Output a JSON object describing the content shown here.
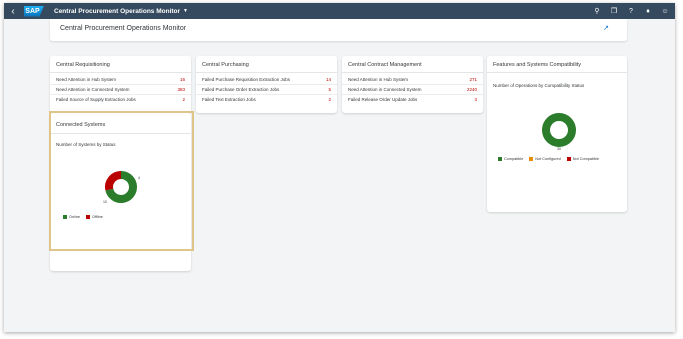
{
  "shell": {
    "title": "Central Procurement Operations Monitor",
    "icons": [
      "back-icon",
      "search-icon",
      "copy-icon",
      "help-icon",
      "bell-icon",
      "user-icon"
    ]
  },
  "page": {
    "title": "Central Procurement Operations Monitor"
  },
  "cards": {
    "requisitioning": {
      "title": "Central Requisitioning",
      "rows": [
        {
          "label": "Need Attention in Hub System",
          "value": "16"
        },
        {
          "label": "Need Attention in Connected System",
          "value": "383"
        },
        {
          "label": "Failed Source of Supply Extraction Jobs",
          "value": "2"
        }
      ]
    },
    "purchasing": {
      "title": "Central Purchasing",
      "rows": [
        {
          "label": "Failed Purchase Requisition Extraction Jobs",
          "value": "14"
        },
        {
          "label": "Failed Purchase Order Extraction Jobs",
          "value": "5"
        },
        {
          "label": "Failed Text Extraction Jobs",
          "value": "2"
        }
      ]
    },
    "contract": {
      "title": "Central Contract Management",
      "rows": [
        {
          "label": "Need Attention in Hub System",
          "value": "271"
        },
        {
          "label": "Need Attention in Connected System",
          "value": "2240"
        },
        {
          "label": "Failed Release Order Update Jobs",
          "value": "3"
        }
      ]
    },
    "features": {
      "title": "Features and Systems Compatibility",
      "subtitle": "Number of Operations by Compatibility Status",
      "legend": [
        "Compatible",
        "Not Configured",
        "Not Compatible"
      ]
    },
    "connected": {
      "title": "Connected Systems",
      "subtitle": "Number of Systems by Status",
      "legend": [
        "Online",
        "Offline"
      ]
    }
  },
  "colors": {
    "shell": "#354a5f",
    "online": "#2b7d2b",
    "offline": "#bb0000",
    "not_configured": "#e78c07",
    "value": "#bb0000",
    "highlight": "#e0c58a"
  },
  "chart_data": [
    {
      "type": "pie",
      "subtitle": "Number of Systems by Status",
      "categories": [
        "Online",
        "Offline"
      ],
      "values": [
        10,
        4
      ],
      "data_labels": [
        "10",
        "4"
      ]
    },
    {
      "type": "pie",
      "subtitle": "Number of Operations by Compatibility Status",
      "categories": [
        "Compatible",
        "Not Configured",
        "Not Compatible"
      ],
      "values": [
        30,
        0,
        0
      ],
      "data_labels": [
        "30"
      ]
    }
  ]
}
